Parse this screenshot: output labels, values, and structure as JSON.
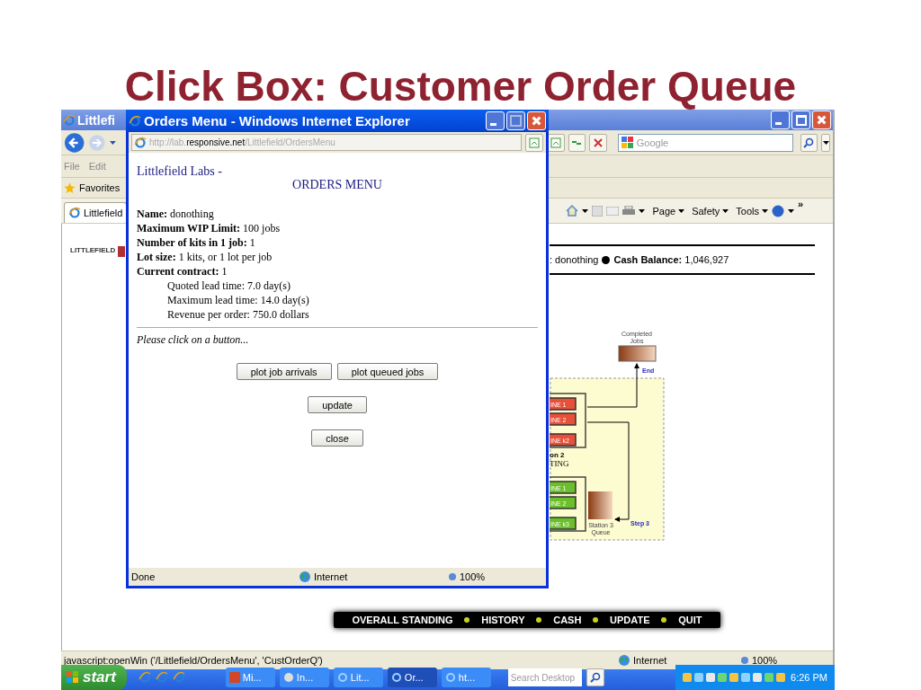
{
  "slide_title": "Click Box: Customer Order Queue",
  "browser": {
    "title": "Littlefi",
    "menu": [
      "File",
      "Edit"
    ],
    "favorites": "Favorites",
    "tab": "Littlefield",
    "search": {
      "placeholder": "Google"
    },
    "commands": [
      "Page",
      "Safety",
      "Tools"
    ],
    "overflow": "»",
    "page": {
      "logo": "LITTLEFIELD",
      "team": ": donothing",
      "cash_label": "Cash Balance:",
      "cash_value": "1,046,927",
      "diagram": {
        "completed": [
          "Completed",
          "Jobs"
        ],
        "end": "End",
        "station2_machines": [
          "INE 1",
          "INE 2",
          "INE k2"
        ],
        "station2_name": [
          "on 2",
          "TING"
        ],
        "station3_machines": [
          "INE 1",
          "INE 2",
          "INE k3"
        ],
        "queue3": [
          "Station 3",
          "Queue"
        ],
        "step": "Step 3"
      },
      "nav": [
        "OVERALL STANDING",
        "HISTORY",
        "CASH",
        "UPDATE",
        "QUIT"
      ]
    },
    "status_bar": {
      "text": "javascript:openWin ('/Littlefield/OrdersMenu', 'CustOrderQ')",
      "zone": "Internet",
      "zoom": "100%"
    }
  },
  "popup": {
    "title": "Orders Menu - Windows Internet Explorer",
    "address": {
      "start": "http://lab.",
      "domain": "responsive.net",
      "path": "/Littlefield/OrdersMenu"
    },
    "site": "Littlefield Labs -",
    "heading": "ORDERS MENU",
    "fields": [
      "**Name:** donothing",
      "**Maximum WIP Limit:** 100 jobs",
      "**Number of kits in 1 job:** 1",
      "**Lot size:** 1 kits, or 1 lot per job",
      "**Current contract:** 1"
    ],
    "contract": [
      "Quoted lead time: 7.0 day(s)",
      "Maximum lead time: 14.0 day(s)",
      "Revenue per order: 750.0 dollars"
    ],
    "prompt": "Please click on a button...",
    "button_rows": [
      [
        "plot job arrivals",
        "plot queued jobs"
      ],
      [
        "update"
      ],
      [
        "close"
      ]
    ],
    "status_bar": {
      "text": "Done",
      "zone": "Internet",
      "zoom": "100%"
    }
  },
  "taskbar": {
    "start": "start",
    "tasks": [
      {
        "label": "Mi...",
        "kind": "slides",
        "selected": false
      },
      {
        "label": "In...",
        "kind": "app",
        "selected": false
      },
      {
        "label": "Lit...",
        "kind": "ie",
        "selected": false
      },
      {
        "label": "Or...",
        "kind": "ie",
        "selected": true
      },
      {
        "label": "ht...",
        "kind": "ie",
        "selected": false
      }
    ],
    "search": {
      "placeholder": "Search Desktop"
    },
    "clock": "6:26 PM"
  }
}
